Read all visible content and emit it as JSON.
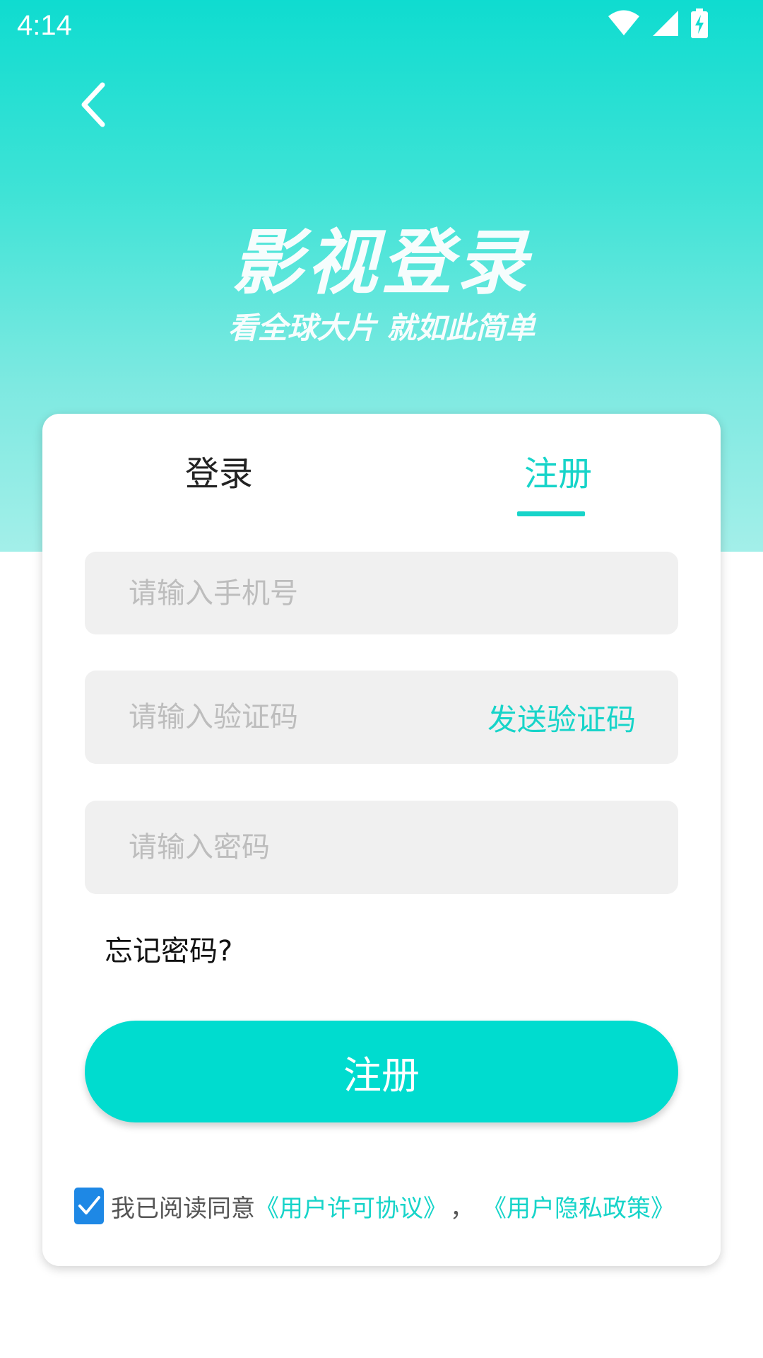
{
  "status_bar": {
    "time": "4:14"
  },
  "hero": {
    "title": "影视登录",
    "subtitle": "看全球大片 就如此简单"
  },
  "tabs": {
    "login_label": "登录",
    "register_label": "注册",
    "active": "register"
  },
  "form": {
    "phone_placeholder": "请输入手机号",
    "code_placeholder": "请输入验证码",
    "send_code_label": "发送验证码",
    "password_placeholder": "请输入密码",
    "forgot_label": "忘记密码?",
    "submit_label": "注册"
  },
  "agreement": {
    "checked": true,
    "text": "我已阅读同意",
    "license_link": "《用户许可协议》",
    "separator": "，",
    "privacy_link": "《用户隐私政策》"
  },
  "colors": {
    "accent": "#17d4c9",
    "button": "#00dccf",
    "checkbox": "#1e88e5"
  },
  "icons": {
    "back": "chevron-left-icon",
    "wifi": "wifi-icon",
    "signal": "signal-icon",
    "battery": "battery-charging-icon",
    "check": "checkmark-icon"
  }
}
